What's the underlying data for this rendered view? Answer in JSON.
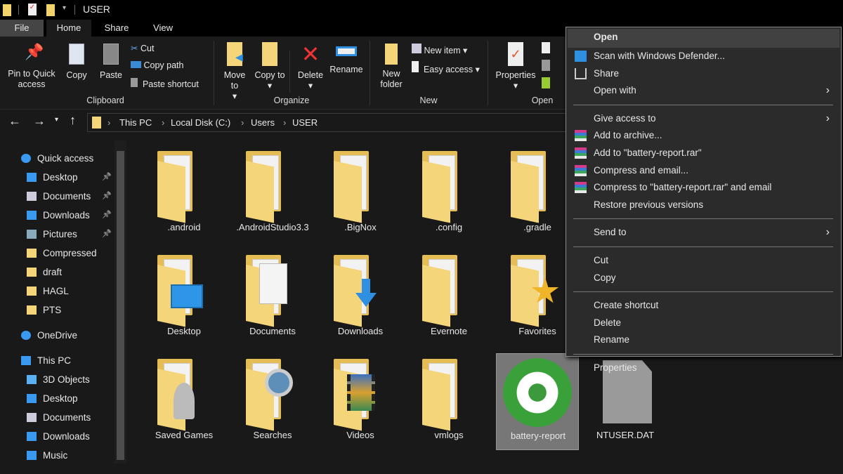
{
  "window": {
    "title": "USER"
  },
  "tabs": [
    "File",
    "Home",
    "Share",
    "View"
  ],
  "ribbon": {
    "pin": "Pin to Quick access",
    "copy": "Copy",
    "paste": "Paste",
    "cut": "Cut",
    "copy_path": "Copy path",
    "paste_shortcut": "Paste shortcut",
    "move_to": "Move to",
    "copy_to": "Copy to",
    "delete": "Delete",
    "rename": "Rename",
    "new_folder": "New folder",
    "new_item": "New item",
    "easy_access": "Easy access",
    "properties": "Properties",
    "groups": {
      "clipboard": "Clipboard",
      "organize": "Organize",
      "new": "New",
      "open": "Open"
    }
  },
  "address": {
    "crumbs": [
      "This PC",
      "Local Disk (C:)",
      "Users",
      "USER"
    ]
  },
  "sidebar": [
    {
      "label": "Quick access",
      "icon": "star-icon",
      "indent": 0,
      "pinned": false
    },
    {
      "label": "Desktop",
      "icon": "desktop-icon",
      "indent": 1,
      "pinned": true
    },
    {
      "label": "Documents",
      "icon": "documents-icon",
      "indent": 1,
      "pinned": true
    },
    {
      "label": "Downloads",
      "icon": "downloads-icon",
      "indent": 1,
      "pinned": true
    },
    {
      "label": "Pictures",
      "icon": "pictures-icon",
      "indent": 1,
      "pinned": true
    },
    {
      "label": "Compressed",
      "icon": "folder-icon",
      "indent": 1,
      "pinned": false
    },
    {
      "label": "draft",
      "icon": "folder-icon",
      "indent": 1,
      "pinned": false
    },
    {
      "label": "HAGL",
      "icon": "folder-icon",
      "indent": 1,
      "pinned": false
    },
    {
      "label": "PTS",
      "icon": "folder-icon",
      "indent": 1,
      "pinned": false
    },
    {
      "label": "OneDrive",
      "icon": "cloud-icon",
      "indent": 0,
      "pinned": false,
      "gap": true
    },
    {
      "label": "This PC",
      "icon": "computer-icon",
      "indent": 0,
      "pinned": false,
      "gap": true
    },
    {
      "label": "3D Objects",
      "icon": "3d-objects-icon",
      "indent": 1,
      "pinned": false
    },
    {
      "label": "Desktop",
      "icon": "desktop-icon",
      "indent": 1,
      "pinned": false
    },
    {
      "label": "Documents",
      "icon": "documents-icon",
      "indent": 1,
      "pinned": false
    },
    {
      "label": "Downloads",
      "icon": "downloads-icon",
      "indent": 1,
      "pinned": false
    },
    {
      "label": "Music",
      "icon": "music-icon",
      "indent": 1,
      "pinned": false
    }
  ],
  "files": [
    {
      "name": ".android",
      "type": "folder-doc"
    },
    {
      "name": ".AndroidStudio3.3",
      "type": "folder-doc"
    },
    {
      "name": ".BigNox",
      "type": "folder-doc"
    },
    {
      "name": ".config",
      "type": "folder-doc"
    },
    {
      "name": ".gradle",
      "type": "folder-doc"
    },
    {
      "name": "Desktop",
      "type": "folder-desktop"
    },
    {
      "name": "Documents",
      "type": "folder-documents"
    },
    {
      "name": "Downloads",
      "type": "folder-downloads"
    },
    {
      "name": "Evernote",
      "type": "folder-doc"
    },
    {
      "name": "Favorites",
      "type": "folder-favorites"
    },
    {
      "name": "Saved Games",
      "type": "folder-games"
    },
    {
      "name": "Searches",
      "type": "folder-searches"
    },
    {
      "name": "Videos",
      "type": "folder-videos"
    },
    {
      "name": "vmlogs",
      "type": "folder-doc"
    },
    {
      "name": "battery-report",
      "type": "ccleaner-file",
      "selected": true
    },
    {
      "name": "NTUSER.DAT",
      "type": "generic-file"
    }
  ],
  "context_menu": [
    {
      "label": "Open",
      "bold": true,
      "highlight": true
    },
    {
      "label": "Scan with Windows Defender...",
      "icon": "defender-icon"
    },
    {
      "label": "Share",
      "icon": "share-icon"
    },
    {
      "label": "Open with",
      "submenu": true
    },
    {
      "sep": true
    },
    {
      "label": "Give access to",
      "submenu": true
    },
    {
      "label": "Add to archive...",
      "icon": "winrar-icon"
    },
    {
      "label": "Add to \"battery-report.rar\"",
      "icon": "winrar-icon"
    },
    {
      "label": "Compress and email...",
      "icon": "winrar-icon"
    },
    {
      "label": "Compress to \"battery-report.rar\" and email",
      "icon": "winrar-icon"
    },
    {
      "label": "Restore previous versions"
    },
    {
      "sep": true
    },
    {
      "label": "Send to",
      "submenu": true
    },
    {
      "sep": true
    },
    {
      "label": "Cut"
    },
    {
      "label": "Copy"
    },
    {
      "sep": true
    },
    {
      "label": "Create shortcut"
    },
    {
      "label": "Delete"
    },
    {
      "label": "Rename"
    },
    {
      "sep": true
    },
    {
      "label": "Properties"
    }
  ],
  "colors": {
    "folder": "#f5d57a",
    "accent_blue": "#2f8fe0",
    "selected": "#777777",
    "menu_bg": "#2b2b2b"
  }
}
